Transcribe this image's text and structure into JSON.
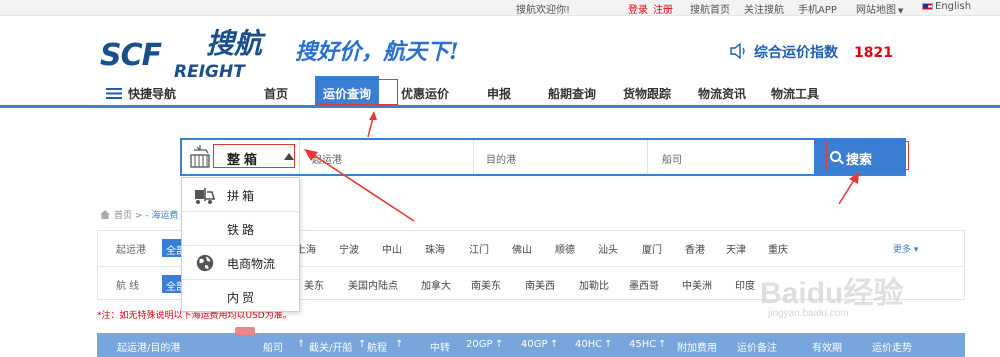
{
  "topbar": {
    "welcome": "搜航欢迎你!",
    "login": "登录",
    "register": "注册",
    "home": "搜航首页",
    "follow": "关注搜航",
    "app": "手机APP",
    "sitemap": "网站地图",
    "language": "English"
  },
  "header": {
    "logo_main": "SCF",
    "logo_sub": "REIGHT",
    "logo_cn": "搜航",
    "slogan": "搜好价，航天下!",
    "index_label": "综合运价指数",
    "index_value": "1821"
  },
  "nav": {
    "quick": "快捷导航",
    "tabs": [
      "首页",
      "运价查询",
      "优惠运价",
      "申报",
      "船期查询",
      "货物跟踪",
      "物流资讯",
      "物流工具"
    ],
    "active": "运价查询"
  },
  "search": {
    "type": "整箱",
    "pol_placeholder": "起运港",
    "pod_placeholder": "目的港",
    "carrier_placeholder": "船司",
    "button": "搜索"
  },
  "dropdown": {
    "options": [
      {
        "label": "拼箱",
        "icon": "forklift-icon"
      },
      {
        "label": "铁路",
        "icon": ""
      },
      {
        "label": "电商物流",
        "icon": "globe-icon"
      },
      {
        "label": "内贸",
        "icon": ""
      }
    ]
  },
  "breadcrumb": {
    "home": "首页",
    "sep": ">",
    "current": "- 海运费"
  },
  "filters": {
    "pol_label": "起运港",
    "all": "全部",
    "pol_options": [
      "上海",
      "宁波",
      "中山",
      "珠海",
      "江门",
      "佛山",
      "顺德",
      "汕头",
      "厦门",
      "香港",
      "天津",
      "重庆"
    ],
    "more": "更多",
    "route_label": "航 线",
    "route_options": [
      "美东",
      "美国内陆点",
      "加拿大",
      "南美东",
      "南美西",
      "加勒比",
      "墨西哥",
      "中美洲",
      "印度"
    ]
  },
  "note": "*注：如无特殊说明以下海运费用均以USD为准。",
  "table": {
    "headers": [
      "起运港/目的港",
      "船司",
      "截关/开船",
      "航程",
      "中转",
      "20GP",
      "40GP",
      "40HC",
      "45HC",
      "附加费用",
      "运价备注",
      "有效期",
      "运价走势"
    ]
  },
  "watermark": {
    "main": "Baidu经验",
    "sub": "jingyan.baidu.com"
  }
}
